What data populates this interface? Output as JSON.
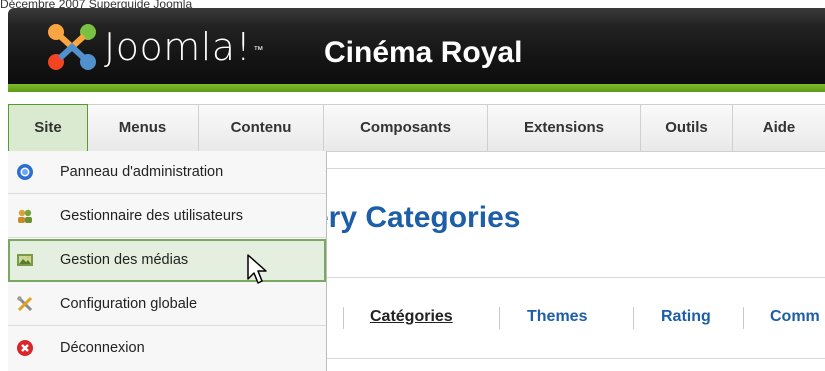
{
  "caption": "Décembre 2007 Superguide Joomla",
  "header": {
    "brand": "Joomla!",
    "site_title": "Cinéma Royal"
  },
  "menubar": {
    "items": [
      {
        "label": "Site"
      },
      {
        "label": "Menus"
      },
      {
        "label": "Contenu"
      },
      {
        "label": "Composants"
      },
      {
        "label": "Extensions"
      },
      {
        "label": "Outils"
      },
      {
        "label": "Aide"
      }
    ]
  },
  "dropdown": {
    "items": [
      {
        "label": "Panneau d'administration",
        "icon": "control-panel-icon"
      },
      {
        "label": "Gestionnaire des utilisateurs",
        "icon": "users-icon"
      },
      {
        "label": "Gestion des médias",
        "icon": "media-icon"
      },
      {
        "label": "Configuration globale",
        "icon": "tools-icon"
      },
      {
        "label": "Déconnexion",
        "icon": "logout-icon"
      }
    ]
  },
  "content": {
    "heading": "ery Categories",
    "tabs": [
      {
        "label": "Catégories"
      },
      {
        "label": "Themes"
      },
      {
        "label": "Rating"
      },
      {
        "label": "Comm"
      }
    ]
  },
  "colors": {
    "accent_green": "#6aab1f",
    "link_blue": "#1d5ea8",
    "header_dark": "#141414"
  }
}
